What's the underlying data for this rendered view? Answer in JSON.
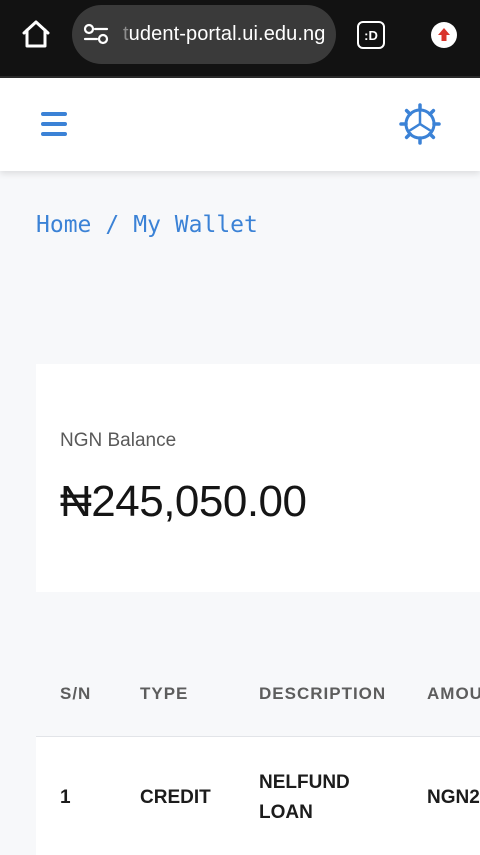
{
  "browser": {
    "url_faded": "t",
    "url_rest": "udent-portal.ui.edu.ng",
    "tab_label": ":D",
    "icons": [
      "home-icon",
      "tune-icon",
      "tab-switcher-icon",
      "extension-icon"
    ]
  },
  "header": {
    "menu_icon": "hamburger-menu-icon",
    "settings_icon": "gear-icon",
    "accent": "#3b82d6"
  },
  "breadcrumb": {
    "home": "Home",
    "separator": "/",
    "current": "My Wallet"
  },
  "balance": {
    "label": "NGN Balance",
    "amount": "₦245,050.00"
  },
  "table": {
    "headers": [
      "S/N",
      "TYPE",
      "DESCRIPTION",
      "AMOU"
    ],
    "rows": [
      {
        "sn": "1",
        "type": "CREDIT",
        "description_line1": "NELFUND",
        "description_line2": "LOAN",
        "amount": "NGN2"
      }
    ]
  }
}
